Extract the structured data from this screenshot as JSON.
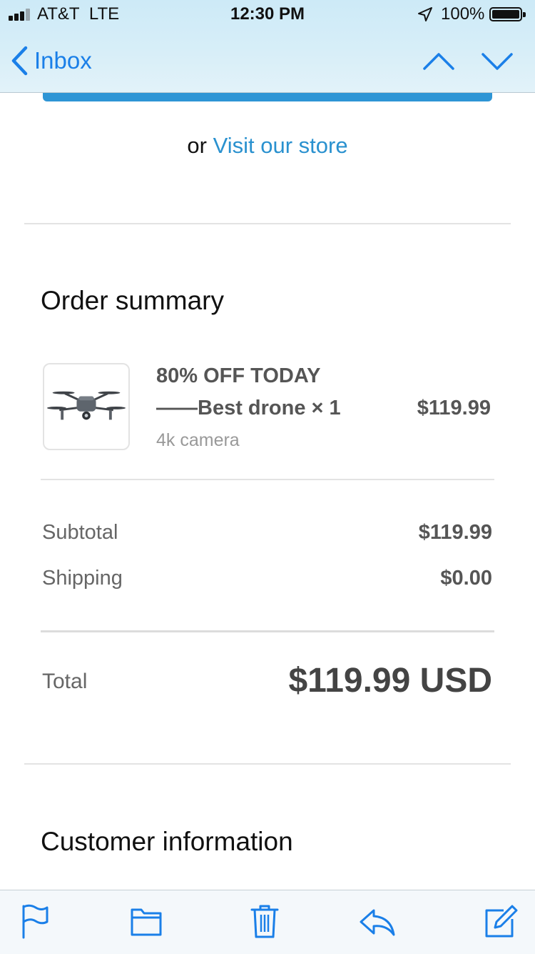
{
  "status_bar": {
    "carrier": "AT&T",
    "network": "LTE",
    "time": "12:30 PM",
    "battery": "100%"
  },
  "nav": {
    "back_label": "Inbox",
    "icons": [
      "chevron-left-icon",
      "chevron-up-icon",
      "chevron-down-icon"
    ]
  },
  "email": {
    "store_prefix": "or",
    "store_link": "Visit our store",
    "order_summary_title": "Order summary",
    "item": {
      "title": "80% OFF TODAY",
      "name": "——Best drone × 1",
      "variant": "4k camera",
      "price": "$119.99",
      "image_icon": "drone-icon"
    },
    "subtotal_label": "Subtotal",
    "subtotal_value": "$119.99",
    "shipping_label": "Shipping",
    "shipping_value": "$0.00",
    "total_label": "Total",
    "total_value": "$119.99 USD",
    "customer_info_title": "Customer information"
  },
  "toolbar": {
    "icons": [
      "flag-icon",
      "folder-icon",
      "trash-icon",
      "reply-icon",
      "compose-icon"
    ]
  },
  "colors": {
    "accent": "#1a7fe8",
    "link": "#2a91cf",
    "button": "#2e95d5"
  }
}
